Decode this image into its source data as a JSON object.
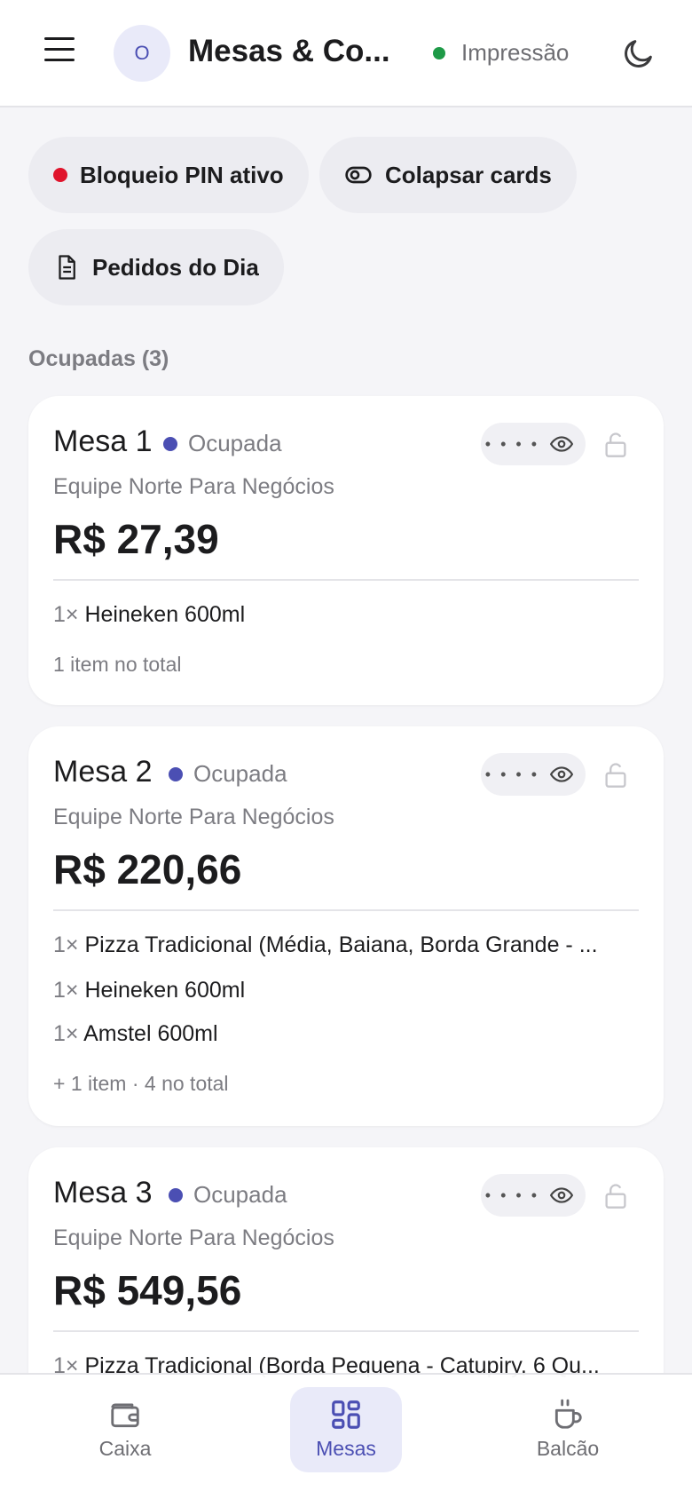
{
  "header": {
    "avatar_initial": "O",
    "title": "Mesas & Co...",
    "print_status": "Impressão"
  },
  "chips": {
    "pin_lock": "Bloqueio PIN ativo",
    "collapse": "Colapsar cards",
    "daily_orders": "Pedidos do Dia"
  },
  "section": {
    "title": "Ocupadas (3)"
  },
  "cards": [
    {
      "title": "Mesa 1",
      "status": "Ocupada",
      "pin_mask": "• • • •",
      "subtitle": "Equipe Norte Para Negócios",
      "total": "R$ 27,39",
      "items": [
        {
          "qty": "1×",
          "name": "Heineken 600ml"
        }
      ],
      "footnote": "1 item no total"
    },
    {
      "title": "Mesa 2",
      "status": "Ocupada",
      "pin_mask": "• • • •",
      "subtitle": "Equipe Norte Para Negócios",
      "total": "R$ 220,66",
      "items": [
        {
          "qty": "1×",
          "name": "Pizza Tradicional (Média, Baiana, Borda Grande - ..."
        },
        {
          "qty": "1×",
          "name": "Heineken 600ml"
        },
        {
          "qty": "1×",
          "name": "Amstel 600ml"
        }
      ],
      "footnote": "+ 1 item · 4 no total"
    },
    {
      "title": "Mesa 3",
      "status": "Ocupada",
      "pin_mask": "• • • •",
      "subtitle": "Equipe Norte Para Negócios",
      "total": "R$ 549,56",
      "items": [
        {
          "qty": "1×",
          "name": "Pizza Tradicional (Borda Pequena - Catupiry, 6 Qu..."
        }
      ]
    }
  ],
  "nav": {
    "caixa": "Caixa",
    "mesas": "Mesas",
    "balcao": "Balcão"
  },
  "colors": {
    "accent": "#4b4fb3",
    "print_ok": "#1e9a47",
    "pin_active": "#e0142c"
  }
}
